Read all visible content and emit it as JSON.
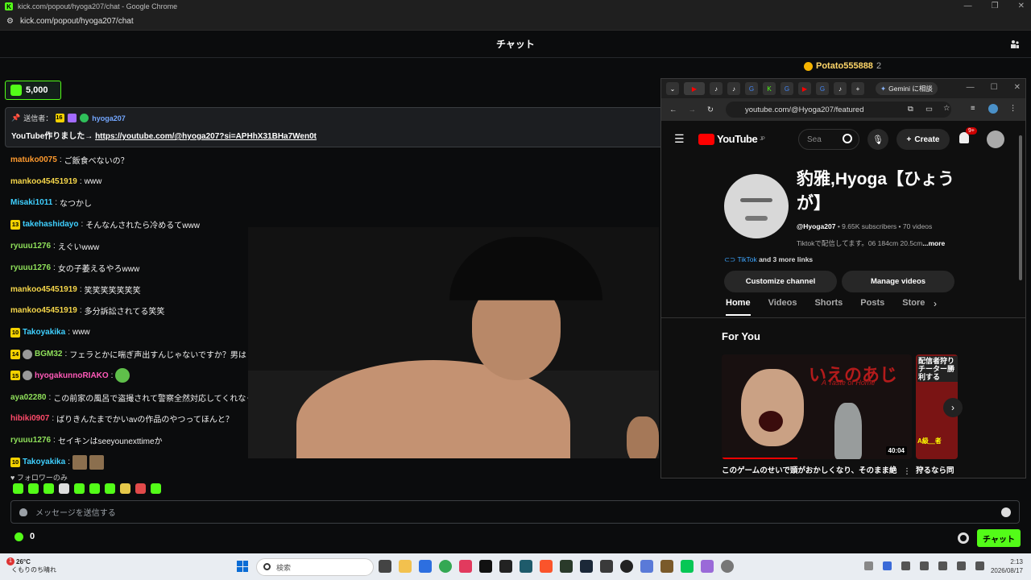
{
  "browser": {
    "title": "kick.com/popout/hyoga207/chat - Google Chrome",
    "url": "kick.com/popout/hyoga207/chat"
  },
  "kick": {
    "header_title": "チャット",
    "top_gifter": {
      "name": "Potato555888",
      "count": "2"
    },
    "kicks_balance": "5,000",
    "pinned": {
      "sender_label": "送信者：",
      "sub_badge": "16",
      "sender": "hyoga207",
      "text_prefix": "YouTube作りました→ ",
      "link": "https://youtube.com/@hyoga207?si=APHhX31BHa7Wen0t"
    },
    "messages": [
      {
        "badge": "",
        "user": "matuko0075",
        "color": "#ff9a2e",
        "text": "ご飯食べないの？"
      },
      {
        "badge": "",
        "user": "mankoo45451919",
        "color": "#f5d64a",
        "text": "www"
      },
      {
        "badge": "",
        "user": "Misaki1011",
        "color": "#3fd0ff",
        "text": "なつかし"
      },
      {
        "badge": "13",
        "user": "takehashidayo",
        "color": "#3fd0ff",
        "text": "そんなんされたら冷めるてwww"
      },
      {
        "badge": "",
        "user": "ryuuu1276",
        "color": "#8fe05a",
        "text": "えぐいwww"
      },
      {
        "badge": "",
        "user": "ryuuu1276",
        "color": "#8fe05a",
        "text": "女の子萎えるやろwww"
      },
      {
        "badge": "",
        "user": "mankoo45451919",
        "color": "#f5d64a",
        "text": "笑笑笑笑笑笑笑"
      },
      {
        "badge": "",
        "user": "mankoo45451919",
        "color": "#f5d64a",
        "text": "多分訴訟されてる笑笑"
      },
      {
        "badge": "10",
        "user": "Takoyakika",
        "color": "#3fd0ff",
        "text": "www"
      },
      {
        "badge": "14",
        "user": "BGM32",
        "color": "#8fe05a",
        "text": "フェラとかに喘ぎ声出すんじゃないですか？男は"
      },
      {
        "badge": "15",
        "user": "hyogakunnoRIAKO",
        "color": "#ff5ab8",
        "text": ""
      },
      {
        "badge": "",
        "user": "aya02280",
        "color": "#8fe05a",
        "text": "この前家の風呂で盗撮されて警察全然対応してくれなくて"
      },
      {
        "badge": "",
        "user": "hibiki0907",
        "color": "#ff4a6a",
        "text": "ばりきんたまでかいavの作品のやつってほんと？"
      },
      {
        "badge": "",
        "user": "ryuuu1276",
        "color": "#8fe05a",
        "text": "セイキンはseeyounexttimeか"
      },
      {
        "badge": "10",
        "user": "Takoyakika",
        "color": "#3fd0ff",
        "text": ""
      }
    ],
    "followers_only": "♥ フォロワーのみ",
    "input_placeholder": "メッセージを送信する",
    "points": "0",
    "send_label": "チャット"
  },
  "popup": {
    "gemini_label": "Gemini に相談",
    "url": "youtube.com/@Hyoga207/featured",
    "yt_logo": "YouTube",
    "yt_region": "JP",
    "search_placeholder": "Sea",
    "create_label": "Create",
    "notif_count": "9+",
    "channel_name": "豹雅,Hyoga【ひょうが】",
    "handle": "@Hyoga207",
    "stats": " • 9.65K subscribers • 70 videos",
    "description": "Tiktokで配信してます。06 184cm 20.5cm",
    "more": "...more",
    "link_name": "TikTok",
    "link_more": " and 3 more links",
    "customize_label": "Customize channel",
    "manage_label": "Manage videos",
    "tabs": [
      "Home",
      "Videos",
      "Shorts",
      "Posts",
      "Store"
    ],
    "for_you": "For You",
    "video1": {
      "thumb_title": "いえのあじ",
      "thumb_sub": "A Taste of Home",
      "duration": "40:04",
      "title": "このゲームのせいで頭がおかしくなり、そのまま絶"
    },
    "video2": {
      "thumb_title": "配信者狩りチーター勝利する",
      "thumb_sub": "A級＿者",
      "title": "狩るなら同"
    }
  },
  "taskbar": {
    "weather_temp": "26°C",
    "weather_desc": "くもりのち晴れ",
    "weather_badge": "1",
    "search_label": "検索",
    "time": "2:13",
    "date": "2026/08/17"
  }
}
